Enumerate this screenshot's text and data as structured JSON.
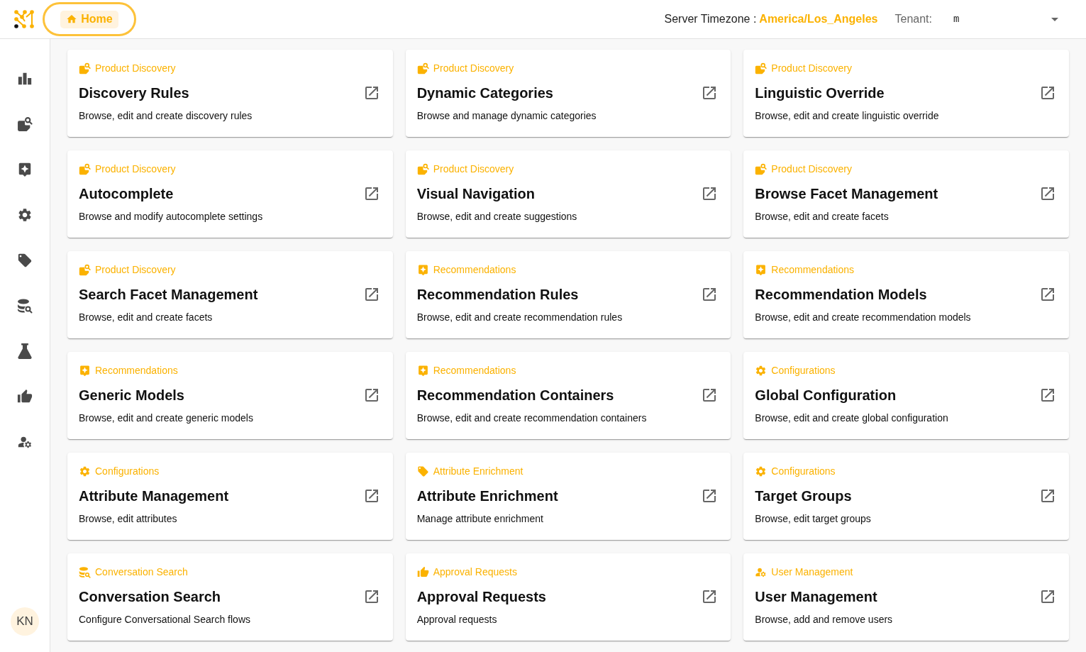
{
  "header": {
    "home_tab": {
      "label": "Home",
      "selected": true,
      "focused": true
    },
    "timezone": {
      "label": "Server Timezone :",
      "value": "America/Los_Angeles"
    },
    "tenant": {
      "label": "Tenant:",
      "value": "m"
    }
  },
  "sidebar": {
    "items": [
      {
        "kind": "analytics"
      },
      {
        "kind": "product_discovery"
      },
      {
        "kind": "recommendations"
      },
      {
        "kind": "configurations"
      },
      {
        "kind": "attribute_enrichment"
      },
      {
        "kind": "conversation_search"
      },
      {
        "kind": "experiments"
      },
      {
        "kind": "approval_requests"
      },
      {
        "kind": "user_management"
      }
    ],
    "avatar": "KN"
  },
  "cards": [
    {
      "category": {
        "kind": "product_discovery",
        "label": "Product Discovery"
      },
      "title": "Discovery Rules",
      "description": "Browse, edit and create discovery rules"
    },
    {
      "category": {
        "kind": "product_discovery",
        "label": "Product Discovery"
      },
      "title": "Dynamic Categories",
      "description": "Browse and manage dynamic categories"
    },
    {
      "category": {
        "kind": "product_discovery",
        "label": "Product Discovery"
      },
      "title": "Linguistic Override",
      "description": "Browse, edit and create linguistic override"
    },
    {
      "category": {
        "kind": "product_discovery",
        "label": "Product Discovery"
      },
      "title": "Autocomplete",
      "description": "Browse and modify autocomplete settings"
    },
    {
      "category": {
        "kind": "product_discovery",
        "label": "Product Discovery"
      },
      "title": "Visual Navigation",
      "description": "Browse, edit and create suggestions"
    },
    {
      "category": {
        "kind": "product_discovery",
        "label": "Product Discovery"
      },
      "title": "Browse Facet Management",
      "description": "Browse, edit and create facets"
    },
    {
      "category": {
        "kind": "product_discovery",
        "label": "Product Discovery"
      },
      "title": "Search Facet Management",
      "description": "Browse, edit and create facets"
    },
    {
      "category": {
        "kind": "recommendations",
        "label": "Recommendations"
      },
      "title": "Recommendation Rules",
      "description": "Browse, edit and create recommendation rules"
    },
    {
      "category": {
        "kind": "recommendations",
        "label": "Recommendations"
      },
      "title": "Recommendation Models",
      "description": "Browse, edit and create recommendation models"
    },
    {
      "category": {
        "kind": "recommendations",
        "label": "Recommendations"
      },
      "title": "Generic Models",
      "description": "Browse, edit and create generic models"
    },
    {
      "category": {
        "kind": "recommendations",
        "label": "Recommendations"
      },
      "title": "Recommendation Containers",
      "description": "Browse, edit and create recommendation containers"
    },
    {
      "category": {
        "kind": "configurations",
        "label": "Configurations"
      },
      "title": "Global Configuration",
      "description": "Browse, edit and create global configuration"
    },
    {
      "category": {
        "kind": "configurations",
        "label": "Configurations"
      },
      "title": "Attribute Management",
      "description": "Browse, edit attributes"
    },
    {
      "category": {
        "kind": "attribute_enrichment",
        "label": "Attribute Enrichment"
      },
      "title": "Attribute Enrichment",
      "description": "Manage attribute enrichment"
    },
    {
      "category": {
        "kind": "configurations",
        "label": "Configurations"
      },
      "title": "Target Groups",
      "description": "Browse, edit target groups"
    },
    {
      "category": {
        "kind": "conversation_search",
        "label": "Conversation Search"
      },
      "title": "Conversation Search",
      "description": "Configure Conversational Search flows"
    },
    {
      "category": {
        "kind": "approval_requests",
        "label": "Approval Requests"
      },
      "title": "Approval Requests",
      "description": "Approval requests"
    },
    {
      "category": {
        "kind": "user_management",
        "label": "User Management"
      },
      "title": "User Management",
      "description": "Browse, add and remove users"
    }
  ]
}
